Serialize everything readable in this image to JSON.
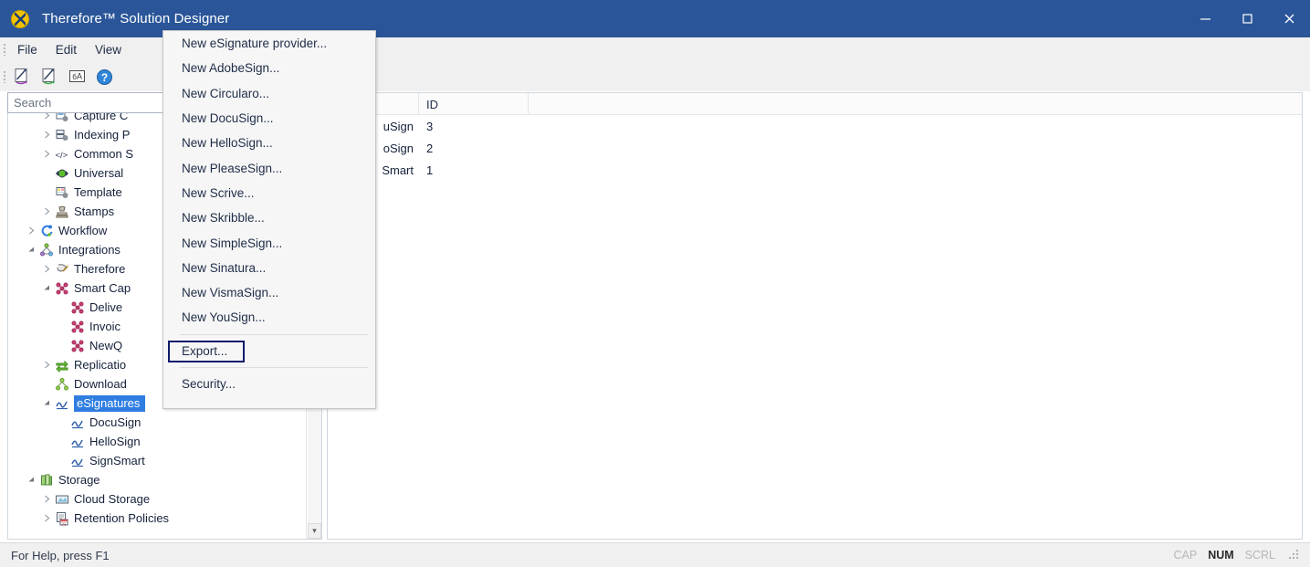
{
  "window": {
    "title": "Therefore™ Solution Designer",
    "icon": "therefore-app-icon",
    "minimize_label": "Minimize",
    "maximize_label": "Maximize",
    "close_label": "Close"
  },
  "menubar": {
    "items": [
      {
        "label": "File"
      },
      {
        "label": "Edit"
      },
      {
        "label": "View"
      }
    ]
  },
  "toolbar": {
    "items": [
      {
        "name": "new-solution-icon",
        "label": "New Solution"
      },
      {
        "name": "open-solution-icon",
        "label": "Open Solution"
      },
      {
        "name": "translation-icon",
        "label": "Translations"
      },
      {
        "name": "help-icon",
        "label": "Help"
      }
    ]
  },
  "search": {
    "placeholder": "Search",
    "value": ""
  },
  "tree": {
    "nodes": [
      {
        "label": "Capture C",
        "icon": "capture-icon",
        "indent": 3,
        "twisty": "collapsed",
        "clipped": true
      },
      {
        "label": "Indexing P",
        "icon": "indexing-icon",
        "indent": 3,
        "twisty": "collapsed",
        "clipped": true
      },
      {
        "label": "Common S",
        "icon": "code-icon",
        "indent": 3,
        "twisty": "collapsed",
        "clipped": true
      },
      {
        "label": "Universal",
        "icon": "universal-icon",
        "indent": 3,
        "twisty": "none",
        "clipped": true
      },
      {
        "label": "Template",
        "icon": "template-icon",
        "indent": 3,
        "twisty": "none",
        "clipped": true
      },
      {
        "label": "Stamps",
        "icon": "stamp-icon",
        "indent": 3,
        "twisty": "collapsed",
        "clipped": false
      },
      {
        "label": "Workflow",
        "icon": "workflow-icon",
        "indent": 2,
        "twisty": "collapsed",
        "clipped": false
      },
      {
        "label": "Integrations",
        "icon": "integrations-icon",
        "indent": 2,
        "twisty": "expanded",
        "clipped": false
      },
      {
        "label": "Therefore",
        "icon": "therefore-connector-icon",
        "indent": 3,
        "twisty": "collapsed",
        "clipped": true
      },
      {
        "label": "Smart Cap",
        "icon": "smart-capture-icon",
        "indent": 3,
        "twisty": "expanded",
        "clipped": true
      },
      {
        "label": "Delive",
        "icon": "smart-capture-icon",
        "indent": 4,
        "twisty": "none",
        "clipped": true
      },
      {
        "label": "Invoic",
        "icon": "smart-capture-icon",
        "indent": 4,
        "twisty": "none",
        "clipped": true
      },
      {
        "label": "NewQ",
        "icon": "smart-capture-icon",
        "indent": 4,
        "twisty": "none",
        "clipped": true
      },
      {
        "label": "Replicatio",
        "icon": "replication-icon",
        "indent": 3,
        "twisty": "collapsed",
        "clipped": true
      },
      {
        "label": "Download",
        "icon": "download-icon",
        "indent": 3,
        "twisty": "none",
        "clipped": true
      },
      {
        "label": "eSignatures",
        "icon": "esignature-icon",
        "indent": 3,
        "twisty": "expanded",
        "clipped": false,
        "selected": true
      },
      {
        "label": "DocuSign",
        "icon": "esignature-icon",
        "indent": 4,
        "twisty": "none",
        "clipped": false
      },
      {
        "label": "HelloSign",
        "icon": "esignature-icon",
        "indent": 4,
        "twisty": "none",
        "clipped": false
      },
      {
        "label": "SignSmart",
        "icon": "esignature-icon",
        "indent": 4,
        "twisty": "none",
        "clipped": false
      },
      {
        "label": "Storage",
        "icon": "storage-icon",
        "indent": 2,
        "twisty": "expanded",
        "clipped": false
      },
      {
        "label": "Cloud Storage",
        "icon": "cloud-storage-icon",
        "indent": 3,
        "twisty": "collapsed",
        "clipped": false
      },
      {
        "label": "Retention Policies",
        "icon": "retention-icon",
        "indent": 3,
        "twisty": "collapsed",
        "clipped": false
      }
    ],
    "scrollbar": {
      "down_arrow": "▾"
    }
  },
  "listview": {
    "columns": [
      {
        "key": "name",
        "label": ""
      },
      {
        "key": "id",
        "label": "ID"
      }
    ],
    "rows": [
      {
        "name": "uSign",
        "id": "3"
      },
      {
        "name": "oSign",
        "id": "2"
      },
      {
        "name": "Smart",
        "id": "1"
      }
    ]
  },
  "popup_menu": {
    "items": [
      {
        "label": "New eSignature provider...",
        "type": "item"
      },
      {
        "label": "New AdobeSign...",
        "type": "item"
      },
      {
        "label": "New Circularo...",
        "type": "item"
      },
      {
        "label": "New DocuSign...",
        "type": "item"
      },
      {
        "label": "New HelloSign...",
        "type": "item"
      },
      {
        "label": "New PleaseSign...",
        "type": "item"
      },
      {
        "label": "New Scrive...",
        "type": "item"
      },
      {
        "label": "New Skribble...",
        "type": "item"
      },
      {
        "label": "New SimpleSign...",
        "type": "item"
      },
      {
        "label": "New Sinatura...",
        "type": "item"
      },
      {
        "label": "New VismaSign...",
        "type": "item"
      },
      {
        "label": "New YouSign...",
        "type": "item"
      },
      {
        "type": "separator"
      },
      {
        "label": "Export...",
        "type": "item",
        "highlighted": true
      },
      {
        "type": "separator"
      },
      {
        "label": "Security...",
        "type": "item"
      }
    ],
    "highlight_color": "#0d1b6b"
  },
  "statusbar": {
    "hint": "For Help, press F1",
    "indicators": [
      {
        "label": "CAP",
        "active": false
      },
      {
        "label": "NUM",
        "active": true
      },
      {
        "label": "SCRL",
        "active": false
      }
    ]
  },
  "colors": {
    "titlebar": "#2a5699",
    "selection": "#2f7de1",
    "highlight_box": "#0d1b6b"
  }
}
